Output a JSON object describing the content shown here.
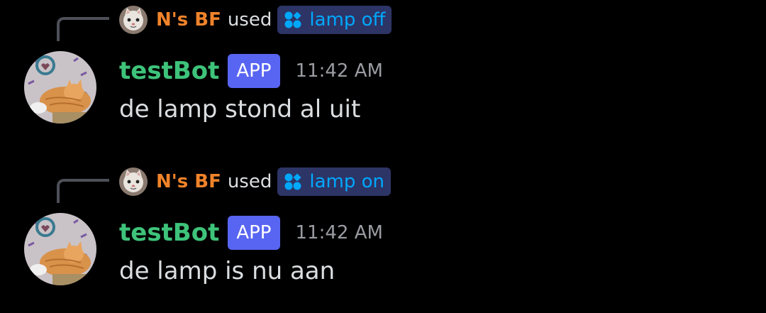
{
  "colors": {
    "command_user": "#f0832a",
    "bot_name": "#3ec37a",
    "app_badge_bg": "#5865f2",
    "chip_bg": "#2d3466",
    "chip_text": "#00a8fc",
    "reply_line": "#4e5058"
  },
  "messages": [
    {
      "interaction": {
        "user": "N's BF",
        "used_text": "used",
        "command": "lamp off",
        "command_icon": "slash-command-icon",
        "avatar_icon": "cat-avatar-icon"
      },
      "author": "testBot",
      "badge": "APP",
      "timestamp": "11:42 AM",
      "content": "de lamp stond al uit",
      "avatar_icon": "cat-avatar-icon"
    },
    {
      "interaction": {
        "user": "N's BF",
        "used_text": "used",
        "command": "lamp on",
        "command_icon": "slash-command-icon",
        "avatar_icon": "cat-avatar-icon"
      },
      "author": "testBot",
      "badge": "APP",
      "timestamp": "11:42 AM",
      "content": "de lamp is nu aan",
      "avatar_icon": "cat-avatar-icon"
    }
  ]
}
